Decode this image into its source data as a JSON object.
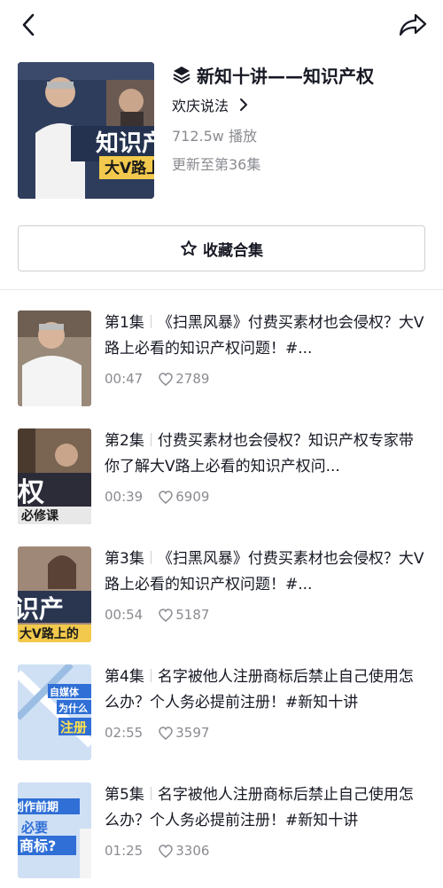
{
  "header": {
    "title": "新知十讲——知识产权",
    "author": "欢庆说法",
    "plays": "712.5w 播放",
    "updated": "更新至第36集",
    "cover_text_1": "知识产",
    "cover_text_2": "大V路上"
  },
  "collect_button": {
    "label": "收藏合集"
  },
  "episodes": [
    {
      "no": "第1集",
      "title": "《扫黑风暴》付费买素材也会侵权？大V路上必看的知识产权问题！#...",
      "duration": "00:47",
      "likes": "2789"
    },
    {
      "no": "第2集",
      "title": "付费买素材也会侵权？知识产权专家带你了解大V路上必看的知识产权问...",
      "duration": "00:39",
      "likes": "6909",
      "thumb_text_1": "权",
      "thumb_text_2": "必修课"
    },
    {
      "no": "第3集",
      "title": "《扫黑风暴》付费买素材也会侵权？大V路上必看的知识产权问题！#...",
      "duration": "00:54",
      "likes": "5187",
      "thumb_text_1": "识产",
      "thumb_text_2": "大V路上的"
    },
    {
      "no": "第4集",
      "title": "名字被他人注册商标后禁止自己使用怎么办？个人务必提前注册！#新知十讲",
      "duration": "02:55",
      "likes": "3597",
      "thumb_text_1": "自媒体",
      "thumb_text_2": "为什么",
      "thumb_text_3": "注册"
    },
    {
      "no": "第5集",
      "title": "名字被他人注册商标后禁止自己使用怎么办？个人务必提前注册！#新知十讲",
      "duration": "01:25",
      "likes": "3306",
      "thumb_text_1": "创作前期",
      "thumb_text_2": "必要",
      "thumb_text_3": "商标?"
    }
  ],
  "colors": {
    "text": "#161823",
    "muted": "#8a8b91",
    "border": "#cfcfd3"
  },
  "icons": {
    "back": "chevron-left-icon",
    "share": "share-arrow-icon",
    "collection": "layers-icon",
    "author_arrow": "chevron-right-icon",
    "collect": "star-outline-icon",
    "likes": "heart-outline-icon"
  }
}
